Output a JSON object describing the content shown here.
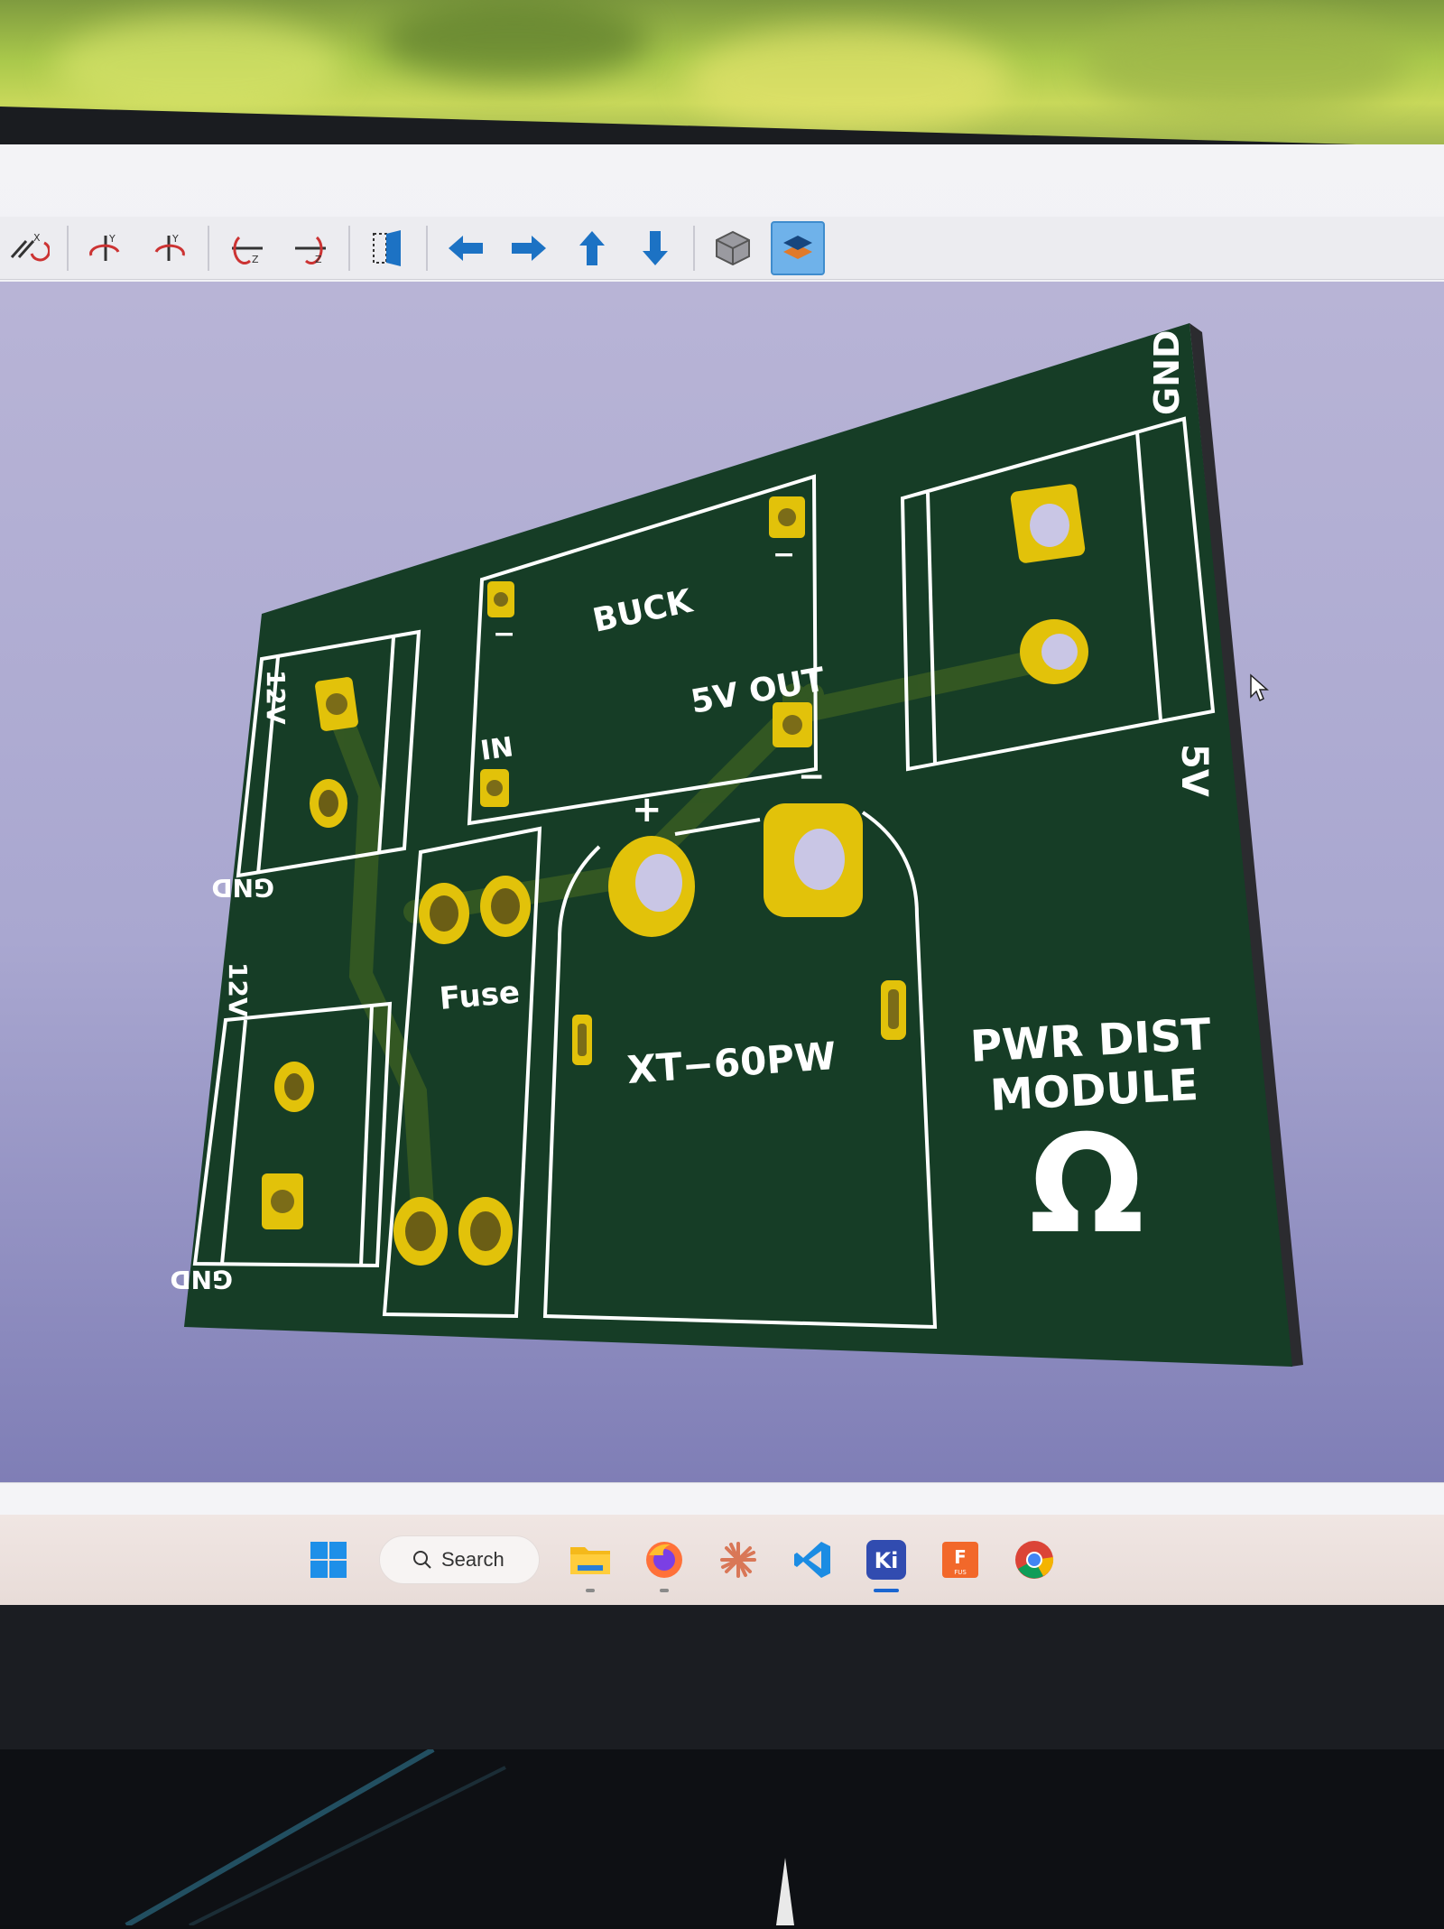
{
  "toolbar": {
    "icons": [
      "rotate-x-icon",
      "rotate-y-ccw-icon",
      "rotate-y-cw-icon",
      "rotate-z-ccw-icon",
      "rotate-z-cw-icon",
      "flip-board-icon",
      "pan-left-icon",
      "pan-right-icon",
      "pan-up-icon",
      "pan-down-icon",
      "orthographic-icon",
      "layers-toggle-icon"
    ],
    "active": "layers-toggle-icon"
  },
  "pcb": {
    "connector_left_top": {
      "top_label": "12V",
      "bottom_label": "GND"
    },
    "connector_left_bottom": {
      "top_label": "12V",
      "bottom_label": "GND"
    },
    "buck": {
      "label": "BUCK",
      "in_label": "IN",
      "out_label": "5V OUT",
      "minus_top_left": "−",
      "minus_top_right": "−",
      "minus_bottom": "−"
    },
    "fuse": {
      "label": "Fuse"
    },
    "xt60": {
      "label": "XT−60PW",
      "plus": "+",
      "minus": "−"
    },
    "connector_right": {
      "top_label": "GND",
      "bottom_label": "5V"
    },
    "module_title_line1": "PWR DIST",
    "module_title_line2": "MODULE",
    "logo": "Ω"
  },
  "taskbar": {
    "search_label": "Search",
    "apps": [
      "windows-start-icon",
      "file-explorer-icon",
      "firefox-icon",
      "claude-icon",
      "vscode-icon",
      "kicad-icon",
      "fusion-icon",
      "chrome-icon"
    ],
    "kicad_badge": "Ki",
    "fusion_badge": "F",
    "fusion_sub": "FUS"
  },
  "colors": {
    "board": "#163d26",
    "pad": "#e2c20a",
    "silkscreen": "#ffffff",
    "viewport": "#aaa8d1",
    "accent": "#1a66d1"
  }
}
